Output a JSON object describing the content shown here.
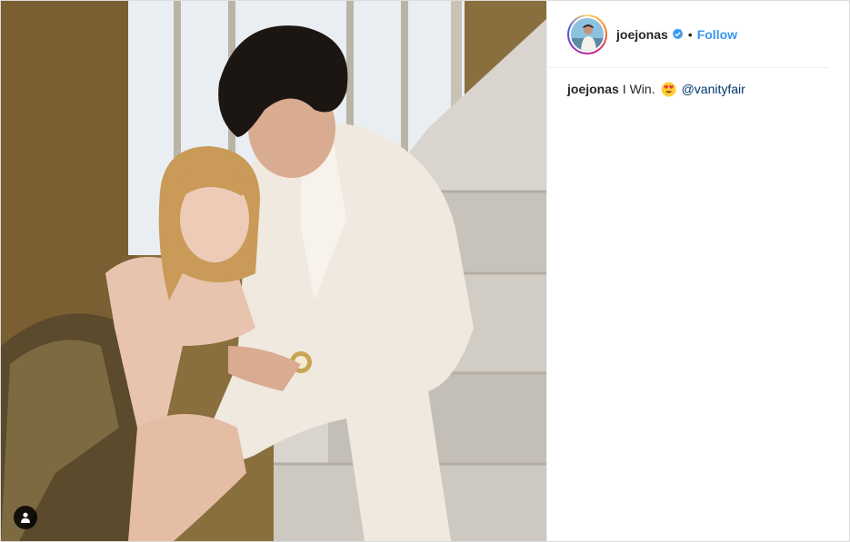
{
  "post": {
    "username": "joejonas",
    "verified_icon": "verified-badge-icon",
    "separator": "•",
    "follow_label": "Follow",
    "caption": {
      "username": "joejonas",
      "text": "I Win.",
      "emoji": "heart-eyes-emoji",
      "mention": "@vanityfair"
    },
    "tag_icon": "user-tag-icon"
  },
  "colors": {
    "follow": "#3897f0",
    "mention": "#003569",
    "text": "#262626",
    "border": "#dbdbdb",
    "verified": "#3897f0"
  }
}
